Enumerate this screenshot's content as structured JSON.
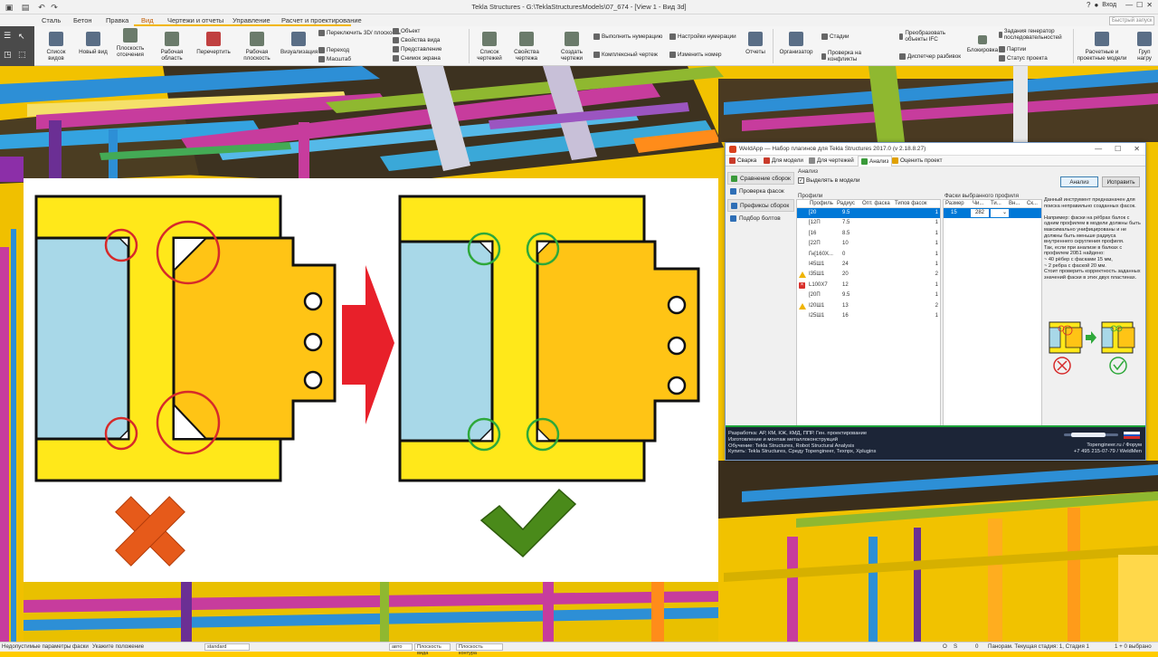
{
  "window": {
    "title": "Tekla Structures - G:\\TeklaStructuresModels\\07_674 - [View 1 - Вид 3d]",
    "help": "?",
    "login": "Вход",
    "minimize": "—",
    "maximize": "☐",
    "close": "✕"
  },
  "menu_tabs": [
    "Сталь",
    "Бетон",
    "Правка",
    "Вид",
    "Чертежи и отчеты",
    "Управление",
    "Расчет и проектирование"
  ],
  "active_tab": "Вид",
  "quick_search_placeholder": "Быстрый запуск",
  "ribbon": {
    "buttons": [
      "Список видов",
      "Новый вид",
      "Плоскость отсечения",
      "Рабочая область",
      "Перечертить",
      "Рабочая плоскость",
      "Визуализация"
    ],
    "view_small": [
      "Переключить 3D/ плоскость",
      "Переход",
      "Масштаб",
      "Объект",
      "Свойства вида",
      "Представление",
      "Снимок экрана"
    ],
    "drawing_buttons": [
      "Список чертежей",
      "Свойства чертежа",
      "Создать чертежи"
    ],
    "drawing_small": [
      "Выполнить нумерацию",
      "Настройки нумерации",
      "Комплексный чертеж",
      "Изменить номер"
    ],
    "reports": "Отчеты",
    "manage_buttons": [
      "Организатор"
    ],
    "manage_small": [
      "Стадии",
      "Проверка на конфликты",
      "Преобразовать объекты IFC",
      "Диспетчер разбивок",
      "Блокировка сеансов",
      "Задания генератор последовательностей",
      "Партии",
      "Статус проекта"
    ],
    "analysis_buttons": [
      "Расчетные и проектные модели",
      "Груп нагру"
    ]
  },
  "plugin": {
    "title": "WeldApp — Набор плагинов для Tekla Structures 2017.0 (v 2.18.8.27)",
    "tabs": [
      "Сварка",
      "Для модели",
      "Для чертежей",
      "Анализ",
      "Оценить проект"
    ],
    "active_tab": "Анализ",
    "side_items": [
      "Сравнение сборок",
      "Проверка фасок",
      "Префиксы сборок",
      "Подбор болтов"
    ],
    "analysis_label": "Анализ",
    "select_in_model": "Выделять в модели",
    "btn_analyze": "Анализ",
    "btn_fix": "Исправить",
    "profiles_title": "Профили",
    "profile_headers": [
      "Профиль",
      "Радиус",
      "Опт. фаска",
      "Типов фасок"
    ],
    "profiles": [
      {
        "status": "",
        "name": "[20",
        "radius": "9.5",
        "opt": "",
        "types": "1",
        "selected": true
      },
      {
        "status": "",
        "name": "[12П",
        "radius": "7.5",
        "opt": "",
        "types": "1"
      },
      {
        "status": "",
        "name": "[16",
        "radius": "8.5",
        "opt": "",
        "types": "1"
      },
      {
        "status": "",
        "name": "[22П",
        "radius": "10",
        "opt": "",
        "types": "1"
      },
      {
        "status": "",
        "name": "Гн[160Х...",
        "radius": "0",
        "opt": "",
        "types": "1"
      },
      {
        "status": "",
        "name": "I45Ш1",
        "radius": "24",
        "opt": "",
        "types": "1"
      },
      {
        "status": "warn",
        "name": "I35Ш1",
        "radius": "20",
        "opt": "",
        "types": "2"
      },
      {
        "status": "err",
        "name": "L100X7",
        "radius": "12",
        "opt": "",
        "types": "1"
      },
      {
        "status": "",
        "name": "[20П",
        "radius": "9.5",
        "opt": "",
        "types": "1"
      },
      {
        "status": "warn",
        "name": "I20Ш1",
        "radius": "13",
        "opt": "",
        "types": "2"
      },
      {
        "status": "",
        "name": "I25Ш1",
        "radius": "16",
        "opt": "",
        "types": "1"
      }
    ],
    "chamfer_title": "Фаски выбранного профиля",
    "chamfer_headers": [
      "Размер",
      "Чи...",
      "Ти...",
      "Вн...",
      "Ск..."
    ],
    "chamfer_rows": [
      {
        "size": "15",
        "count": "282",
        "type": ""
      }
    ],
    "description": "Данный инструмент предназначен для поиска неправильно созданных фасок.\n\nНапример: фаски на рёбрах балок с одним профилем в модели должны быть максимально унифицированы и не должны быть меньше радиуса внутреннего скругления профиля.\nТак, если при анализе в балках с профилем 20Б1 найдено:\n~ 40 рёбер с фасками 15 мм,\n~ 2 ребра с фаской 20 мм.\nСтоит проверить корректность заданных значений фаски в этих двух пластинах.",
    "footer_left": "Разработка: АР, КМ, КЖ, КМД, ППР. Ген. проектирование\nИзготовление и монтаж металлоконструкций\nОбучение: Tekla Structures, Robot Structural Analysis\nКупить: Tekla Structures, Среду Topengineer, Техпрх, Xplugins",
    "footer_right": "Topengineer.ru / Форум\n+7 495 215-07-79 / WeldMen"
  },
  "statusbar": {
    "left": "Недопустимые параметры фаски",
    "hint": "Укажите положение",
    "dropdown1": "standard",
    "dropdown2": "авто",
    "dropdown3": "Плоскость вида",
    "dropdown4": "Плоскость контура",
    "o": "O",
    "s": "S",
    "zero": "0",
    "phase": "Панорам. Текущая стадия: 1, Стадия 1",
    "selected": "1 + 0 выбрано"
  },
  "colors": {
    "accent": "#f2b600",
    "selection": "#0078d7",
    "error_red": "#e03030",
    "ok_green": "#2ea83a"
  }
}
